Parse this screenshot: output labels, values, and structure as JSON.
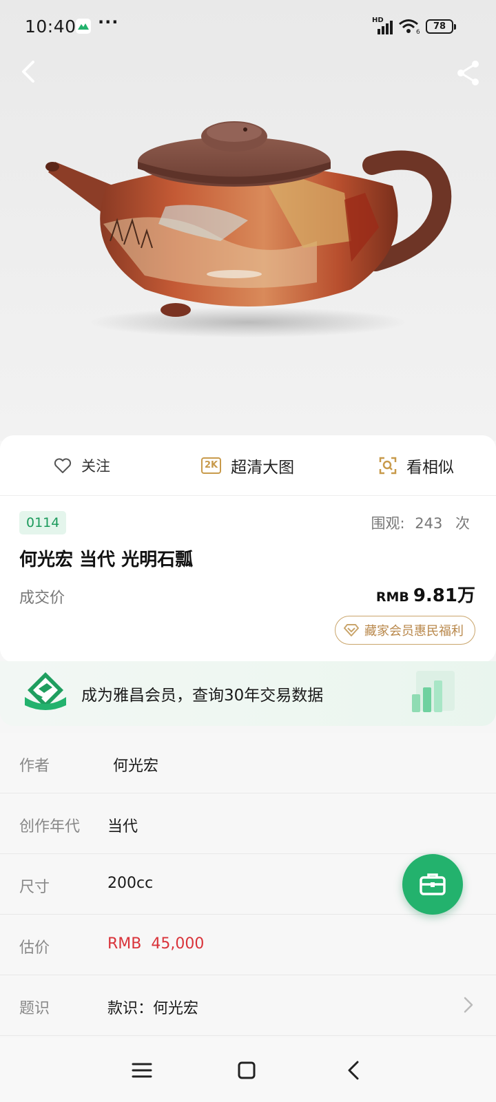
{
  "status_bar": {
    "time": "10:40",
    "dots": "···",
    "network_label": "HD",
    "wifi_badge": "6",
    "battery": "78"
  },
  "header": {
    "back_icon": "chevron-left-icon",
    "share_icon": "share-icon"
  },
  "actions": {
    "follow_label": "关注",
    "hd_badge": "2K",
    "hd_label": "超清大图",
    "similar_label": "看相似"
  },
  "lot": {
    "number": "0114",
    "views_label": "围观:",
    "views_count": "243",
    "views_unit": "次",
    "title": "何光宏 当代 光明石瓢",
    "price_label": "成交价",
    "price_currency": "RMB",
    "price_value": "9.81万",
    "member_pill": "藏家会员惠民福利"
  },
  "promo": {
    "text": "成为雅昌会员，查询30年交易数据"
  },
  "details": [
    {
      "label": "作者",
      "value": "何光宏"
    },
    {
      "label": "创作年代",
      "value": "当代"
    },
    {
      "label": "尺寸",
      "value": "200cc"
    },
    {
      "label": "估价",
      "currency": "RMB",
      "value": "45,000"
    },
    {
      "label": "题识",
      "value": "款识：何光宏"
    }
  ],
  "colors": {
    "accent_green": "#23b26d",
    "tag_green": "#1c9a5c",
    "gold": "#c89a4b",
    "estimate_red": "#d9333a"
  }
}
